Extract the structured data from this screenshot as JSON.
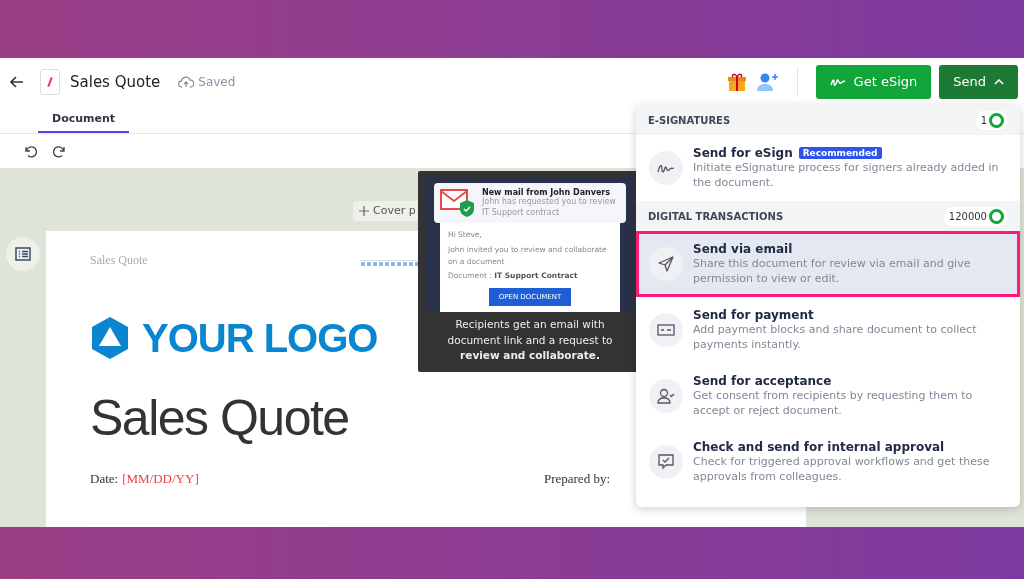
{
  "header": {
    "title": "Sales Quote",
    "save_status": "Saved",
    "buttons": [
      {
        "label": "Get eSign",
        "kind": "esign"
      },
      {
        "label": "Send",
        "kind": "send"
      }
    ]
  },
  "tabs": [
    {
      "label": "Document",
      "selected": true
    }
  ],
  "canvas": {
    "cover_button": "Cover p",
    "page": {
      "running_header": "Sales Quote",
      "logo_text": "YOUR LOGO",
      "title": "Sales Quote",
      "date_label": "Date:",
      "date_value": "[MM/DD/YY]",
      "prepared_label": "Prepared by:"
    }
  },
  "tooltip": {
    "mail_title": "New mail from John Danvers",
    "mail_subtitle": "John has requested you to review IT Support contract",
    "greeting": "Hi Steve,",
    "body": "John invited you to review and collaborate on a document",
    "document_label": "Document :",
    "document_name": "IT Support Contract",
    "button": "OPEN DOCUMENT",
    "caption": "Recipients get an email with document link and a request to **review and collaborate.**"
  },
  "send_menu": {
    "sections": [
      {
        "title": "E-SIGNATURES",
        "count": "1",
        "items": [
          {
            "kind": "esign",
            "title": "Send for eSign",
            "badge": "Recommended",
            "description": "Initiate eSignature process for signers already added in the document.",
            "selected": false
          }
        ]
      },
      {
        "title": "DIGITAL TRANSACTIONS",
        "count": "120000",
        "items": [
          {
            "kind": "email",
            "title": "Send via email",
            "description": "Share this document for review via email and give permission to view or edit.",
            "selected": true
          },
          {
            "kind": "payment",
            "title": "Send for payment",
            "description": "Add payment blocks and share document to collect payments instantly.",
            "selected": false
          },
          {
            "kind": "acceptance",
            "title": "Send for acceptance",
            "description": "Get consent from recipients by requesting them to accept or reject document.",
            "selected": false
          },
          {
            "kind": "approval",
            "title": "Check and send for internal approval",
            "description": "Check for triggered approval workflows and get these approvals from colleagues.",
            "selected": false
          }
        ]
      }
    ]
  }
}
